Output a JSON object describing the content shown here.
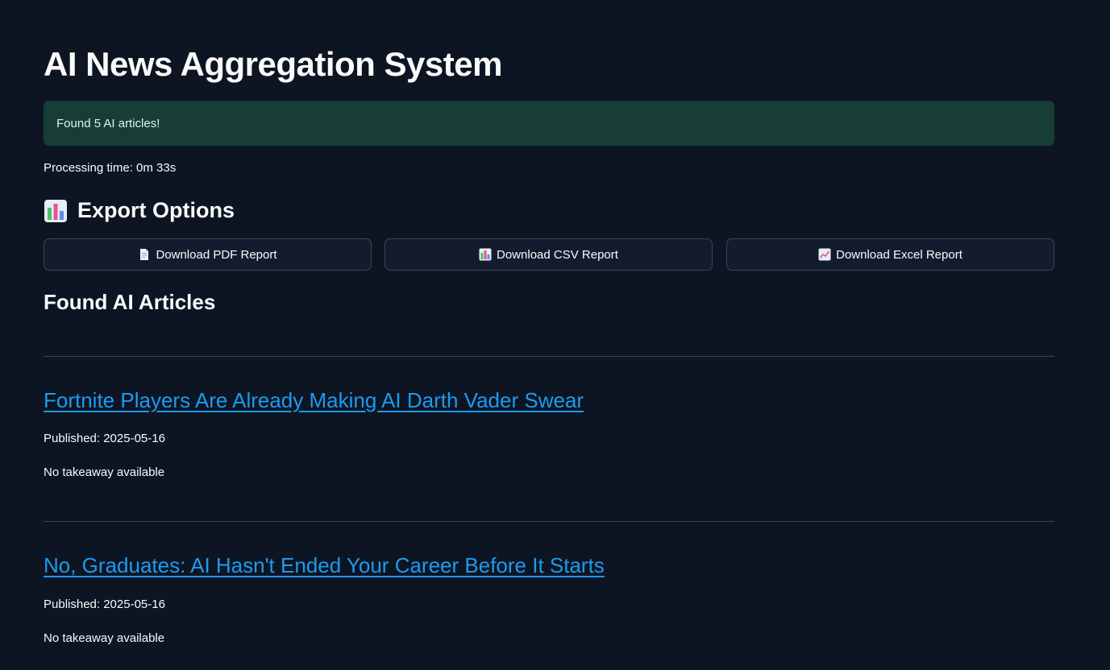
{
  "page": {
    "title": "AI News Aggregation System"
  },
  "status": {
    "success_message": "Found 5 AI articles!",
    "processing_time": "Processing time: 0m 33s"
  },
  "export": {
    "heading": "Export Options",
    "heading_icon": "bar-chart-icon",
    "buttons": [
      {
        "label": "Download PDF Report",
        "icon": "document-icon"
      },
      {
        "label": "Download CSV Report",
        "icon": "bar-chart-icon"
      },
      {
        "label": "Download Excel Report",
        "icon": "line-chart-icon"
      }
    ]
  },
  "articles_section": {
    "heading": "Found AI Articles",
    "articles": [
      {
        "title": "Fortnite Players Are Already Making AI Darth Vader Swear",
        "published": "Published: 2025-05-16",
        "takeaway": "No takeaway available"
      },
      {
        "title": "No, Graduates: AI Hasn't Ended Your Career Before It Starts",
        "published": "Published: 2025-05-16",
        "takeaway": "No takeaway available"
      }
    ]
  },
  "colors": {
    "background": "#0d1523",
    "success_bg": "#173d35",
    "link": "#1c9bf0",
    "button_bg": "#131c2d",
    "button_border": "#3c4556"
  }
}
